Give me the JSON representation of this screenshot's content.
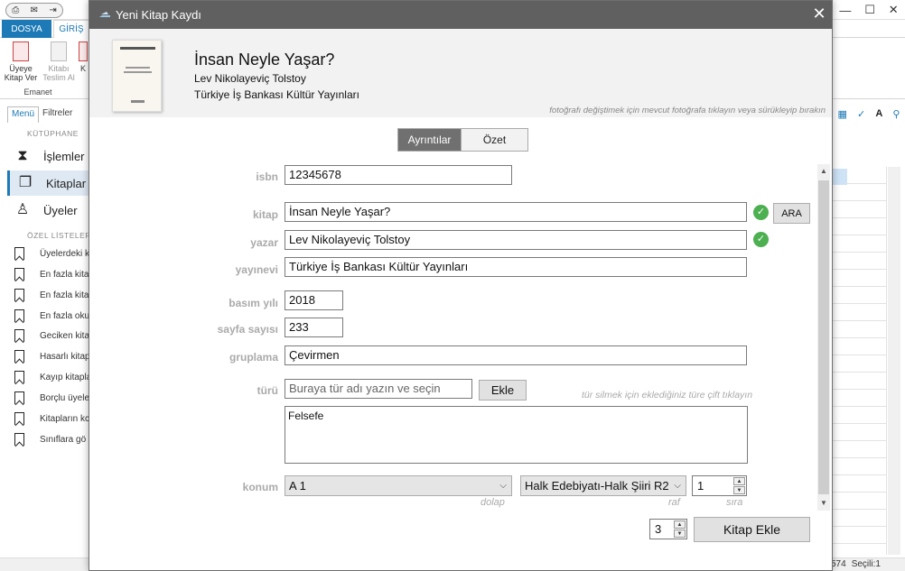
{
  "background_app": {
    "ribbon_tabs": {
      "file": "DOSYA",
      "home": "GİRİŞ"
    },
    "ribbon_buttons": [
      {
        "label": "Üyeye Kitap Ver"
      },
      {
        "label": "Kitabı Teslim Al"
      },
      {
        "label": "K"
      }
    ],
    "ribbon_group": "Emanet",
    "sidebar_tabs": {
      "menu": "Menü",
      "filters": "Filtreler"
    },
    "library_section": "KÜTÜPHANE",
    "library_items": [
      {
        "label": "İşlemler",
        "icon": "hourglass-icon"
      },
      {
        "label": "Kitaplar",
        "icon": "books-icon",
        "active": true
      },
      {
        "label": "Üyeler",
        "icon": "user-icon"
      }
    ],
    "special_lists_section": "ÖZEL LİSTELER",
    "special_lists": [
      "Üyelerdeki k",
      "En fazla kita",
      "En fazla kita",
      "En fazla oku",
      "Geciken kita",
      "Hasarlı kitap",
      "Kayıp kitapla",
      "Borçlu üyele",
      "Kitapların kc",
      "Sınıflara gö"
    ],
    "status_count": "574",
    "status_selected": "Seçili:1"
  },
  "dialog": {
    "title": "Yeni Kitap Kaydı",
    "book_title": "İnsan Neyle Yaşar?",
    "book_author": "Lev Nikolayeviç Tolstoy",
    "book_publisher": "Türkiye İş Bankası Kültür Yayınları",
    "photo_hint": "fotoğrafı değiştimek için mevcut fotoğrafa tıklayın veya sürükleyip bırakın",
    "tabs": {
      "details": "Ayrıntılar",
      "summary": "Özet"
    },
    "fields": {
      "isbn_label": "isbn",
      "isbn_value": "12345678",
      "book_label": "kitap",
      "book_value": "İnsan Neyle Yaşar?",
      "search_button": "ARA",
      "author_label": "yazar",
      "author_value": "Lev Nikolayeviç Tolstoy",
      "publisher_label": "yayınevi",
      "publisher_value": "Türkiye İş Bankası Kültür Yayınları",
      "year_label": "basım yılı",
      "year_value": "2018",
      "pages_label": "sayfa sayısı",
      "pages_value": "233",
      "grouping_label": "gruplama",
      "grouping_value": "Çevirmen",
      "genre_label": "türü",
      "genre_placeholder": "Buraya tür adı yazın ve seçin",
      "genre_add_button": "Ekle",
      "genre_hint": "tür silmek için eklediğiniz türe çift tıklayın",
      "genres": [
        "Felsefe"
      ],
      "location_label": "konum",
      "cabinet_value": "A 1",
      "cabinet_caption": "dolap",
      "shelf_value": "Halk Edebiyatı-Halk Şiiri R2",
      "shelf_caption": "raf",
      "order_value": "1",
      "order_caption": "sıra"
    },
    "copies_value": "3",
    "add_book_button": "Kitap Ekle"
  }
}
